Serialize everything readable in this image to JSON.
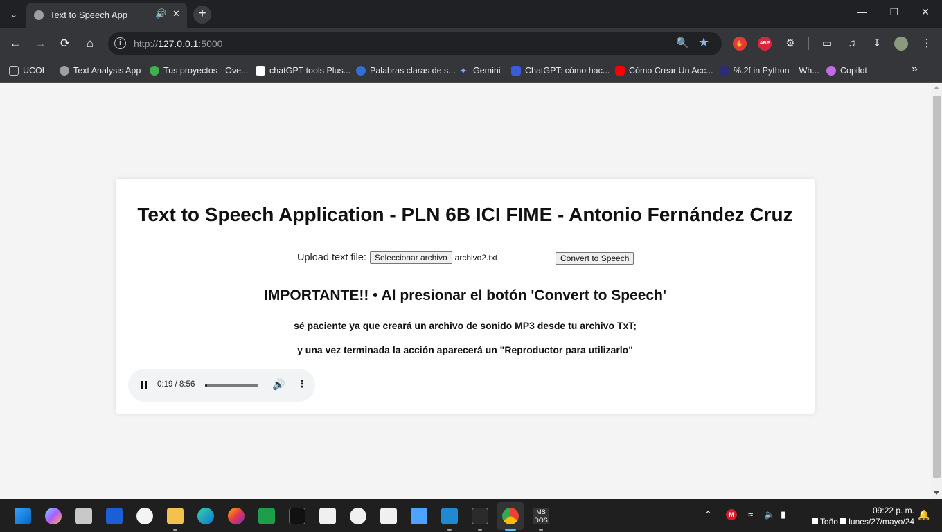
{
  "browser": {
    "tab_title": "Text to Speech App",
    "url_scheme": "http://",
    "url_host": "127.0.0.1",
    "url_port": ":5000",
    "bookmarks": [
      {
        "label": "UCOL",
        "color": "#9aa0a6"
      },
      {
        "label": "Text Analysis App",
        "color": "#9aa0a6"
      },
      {
        "label": "Tus proyectos - Ove...",
        "color": "#3fb24f"
      },
      {
        "label": "chatGPT tools Plus...",
        "color": "#ffffff"
      },
      {
        "label": "Palabras claras de s...",
        "color": "#2f6fd6"
      },
      {
        "label": "Gemini",
        "color": "#7aa7ff"
      },
      {
        "label": "ChatGPT: cómo hac...",
        "color": "#3b5bdb"
      },
      {
        "label": "Cómo Crear Un Acc...",
        "color": "#ff0000"
      },
      {
        "label": "%.2f in Python – Wh...",
        "color": "#2b2d6e"
      },
      {
        "label": "Copilot",
        "color": "#c36ae8"
      }
    ]
  },
  "app": {
    "title": "Text to Speech Application - PLN 6B ICI FIME - Antonio Fernández Cruz",
    "upload_label": "Upload text file:",
    "file_button": "Seleccionar archivo",
    "file_name": "archivo2.txt",
    "convert_button": "Convert to Speech",
    "important_heading": "IMPORTANTE!! • Al presionar el botón 'Convert to Speech'",
    "line1": "sé paciente ya que creará un archivo de sonido MP3 desde tu archivo TxT;",
    "line2": "y una vez terminada la acción aparecerá un \"Reproductor para utilizarlo\"",
    "player": {
      "time": "0:19 / 8:56",
      "progress_fraction": 0.035
    }
  },
  "taskbar": {
    "time": "09:22 p. m.",
    "user": "Toño",
    "date": "lunes/27/mayo/24"
  },
  "colors": {
    "accent": "#8ab4f8",
    "taskbar_active": "#4cc2ff"
  }
}
